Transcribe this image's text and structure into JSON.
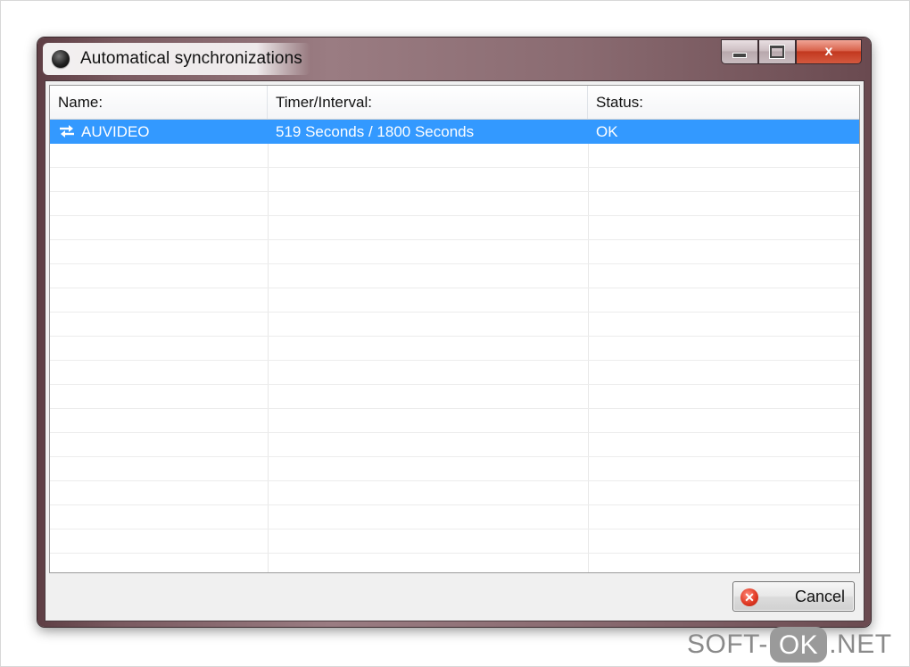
{
  "window": {
    "title": "Automatical synchronizations",
    "close_glyph": "x"
  },
  "table": {
    "columns": [
      "Name:",
      "Timer/Interval:",
      "Status:"
    ],
    "rows": [
      {
        "name": "AUVIDEO",
        "timer": "519 Seconds / 1800 Seconds",
        "status": "OK",
        "icon": "sync-arrows-icon",
        "selected": true
      }
    ]
  },
  "footer": {
    "cancel_label": "Cancel",
    "cancel_icon": "cancel-icon"
  },
  "watermark": {
    "left": "SOFT-",
    "middle": "OK",
    "right": ".NET"
  },
  "colors": {
    "selection": "#3399ff",
    "close_button": "#c2381f"
  }
}
